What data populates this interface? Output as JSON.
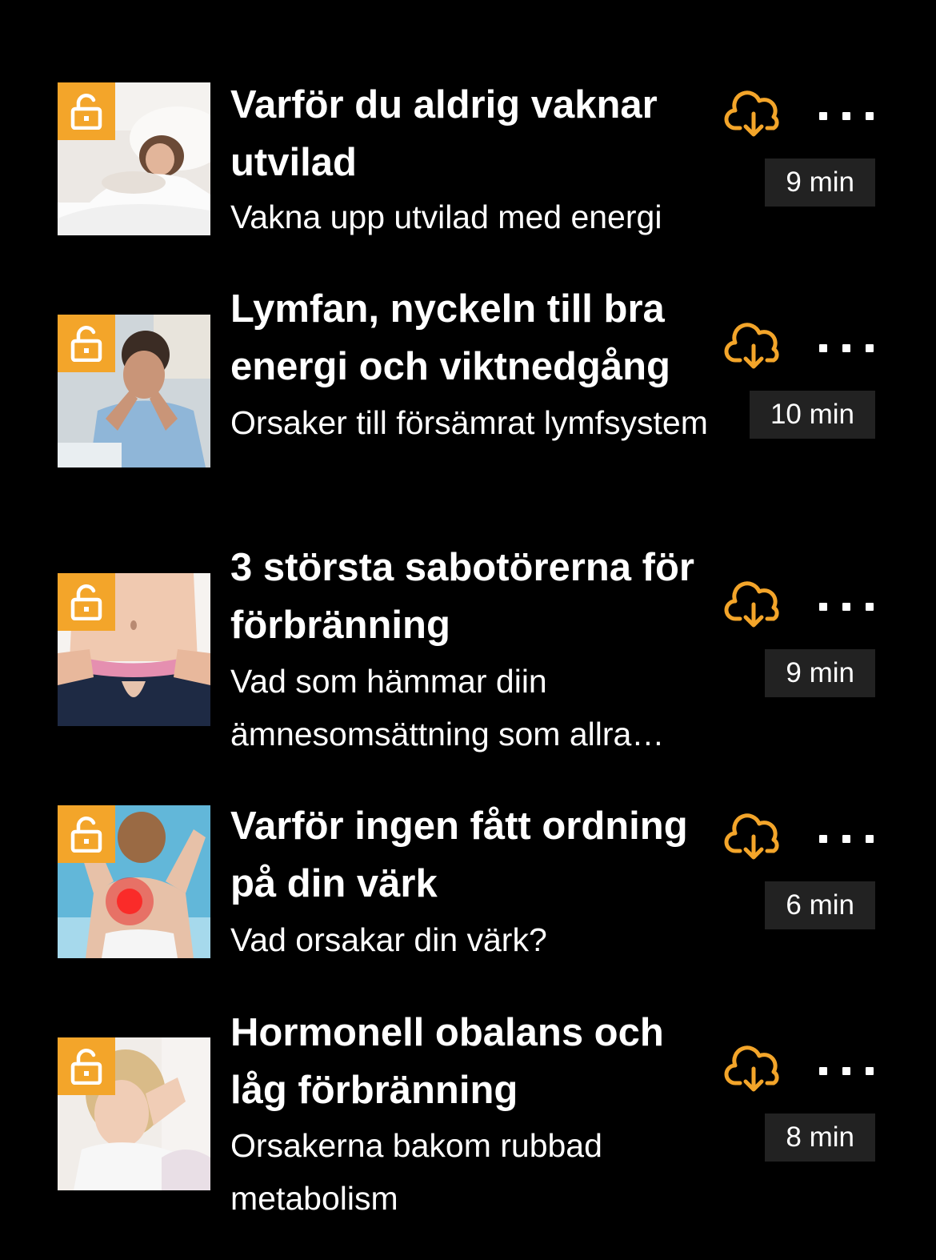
{
  "accent_color": "#f3a52a",
  "episodes": [
    {
      "title": "Varför du aldrig vaknar utvilad",
      "subtitle": "Vakna upp utvilad med energi",
      "duration": "9 min",
      "thumbnail": "sleeping-woman-image",
      "lock_icon": "unlocked-padlock-icon",
      "download_icon": "cloud-download-icon",
      "menu_icon": "more-options-icon"
    },
    {
      "title": "Lymfan, nyckeln till bra energi och viktnedgång",
      "subtitle": "Orsaker till försämrat lymfsystem",
      "duration": "10 min",
      "thumbnail": "tired-man-image",
      "lock_icon": "unlocked-padlock-icon",
      "download_icon": "cloud-download-icon",
      "menu_icon": "more-options-icon"
    },
    {
      "title": "3 största sabotörerna för förbränning",
      "subtitle": "Vad som hämmar diin ämnesomsättning som allra mest",
      "duration": "9 min",
      "thumbnail": "measuring-waist-image",
      "lock_icon": "unlocked-padlock-icon",
      "download_icon": "cloud-download-icon",
      "menu_icon": "more-options-icon"
    },
    {
      "title": "Varför ingen fått ordning på din värk",
      "subtitle": "Vad orsakar din värk?",
      "duration": "6 min",
      "thumbnail": "neck-pain-image",
      "lock_icon": "unlocked-padlock-icon",
      "download_icon": "cloud-download-icon",
      "menu_icon": "more-options-icon"
    },
    {
      "title": "Hormonell obalans och låg förbränning",
      "subtitle": "Orsakerna bakom rubbad metabolism",
      "duration": "8 min",
      "thumbnail": "tired-woman-image",
      "lock_icon": "unlocked-padlock-icon",
      "download_icon": "cloud-download-icon",
      "menu_icon": "more-options-icon"
    }
  ]
}
